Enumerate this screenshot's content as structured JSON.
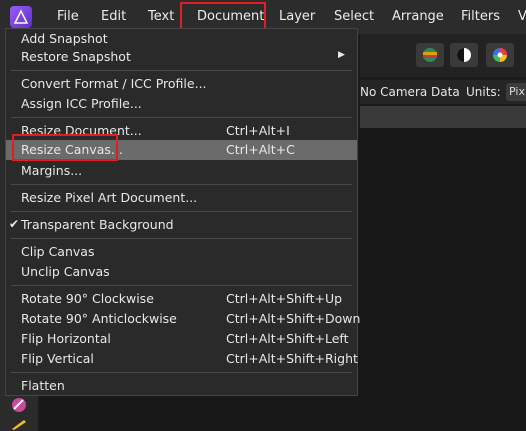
{
  "menubar": {
    "items": [
      "File",
      "Edit",
      "Text",
      "Document",
      "Layer",
      "Select",
      "Arrange",
      "Filters",
      "V"
    ]
  },
  "context_bar": {
    "camera": "No Camera Data",
    "units_label": "Units:",
    "units_value": "Pix"
  },
  "document_menu": {
    "items": [
      {
        "label": "Add Snapshot",
        "shortcut": ""
      },
      {
        "label": "Restore Snapshot",
        "shortcut": ""
      },
      {
        "label": "Convert Format / ICC Profile...",
        "shortcut": ""
      },
      {
        "label": "Assign ICC Profile...",
        "shortcut": ""
      },
      {
        "label": "Resize Document...",
        "shortcut": "Ctrl+Alt+I"
      },
      {
        "label": "Resize Canvas...",
        "shortcut": "Ctrl+Alt+C"
      },
      {
        "label": "Margins...",
        "shortcut": ""
      },
      {
        "label": "Resize Pixel Art Document...",
        "shortcut": ""
      },
      {
        "label": "Transparent Background",
        "shortcut": ""
      },
      {
        "label": "Clip Canvas",
        "shortcut": ""
      },
      {
        "label": "Unclip Canvas",
        "shortcut": ""
      },
      {
        "label": "Rotate 90° Clockwise",
        "shortcut": "Ctrl+Alt+Shift+Up"
      },
      {
        "label": "Rotate 90° Anticlockwise",
        "shortcut": "Ctrl+Alt+Shift+Down"
      },
      {
        "label": "Flip Horizontal",
        "shortcut": "Ctrl+Alt+Shift+Left"
      },
      {
        "label": "Flip Vertical",
        "shortcut": "Ctrl+Alt+Shift+Right"
      },
      {
        "label": "Flatten",
        "shortcut": ""
      }
    ],
    "checked_item": "Transparent Background",
    "highlighted_item": "Resize Canvas..."
  },
  "colors": {
    "highlight_border": "#e31b23",
    "menu_bg": "#2a2a2a",
    "active_row_bg": "#6b6b6b",
    "app_accent": "#7a3fe0"
  },
  "icons": [
    "affinity-photo-logo-icon",
    "color-wheel-icon",
    "contrast-icon",
    "hsl-wheel-icon",
    "submenu-arrow-icon",
    "checkmark-icon",
    "brush-tool-icon"
  ]
}
